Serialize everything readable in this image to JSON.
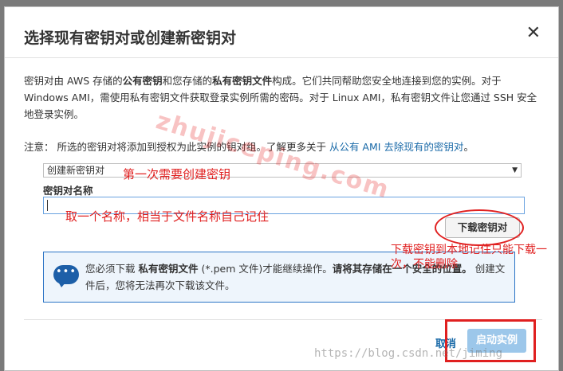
{
  "dialog": {
    "title": "选择现有密钥对或创建新密钥对",
    "close_glyph": "✕",
    "intro_part1": "密钥对由 AWS 存储的",
    "intro_bold1": "公有密钥",
    "intro_part2": "和您存储的",
    "intro_bold2": "私有密钥文件",
    "intro_part3": "构成。它们共同帮助您安全地连接到您的实例。对于 Windows AMI，需使用私有密钥文件获取登录实例所需的密码。对于 Linux AMI，私有密钥文件让您通过 SSH 安全地登录实例。",
    "note_text": "注意：  所选的密钥对将添加到授权为此实例的钥对组。了解更多关于 ",
    "note_link": "从公有 AMI 去除现有的密钥对",
    "note_end": "。",
    "select_value": "创建新密钥对",
    "name_label": "密钥对名称",
    "name_value": "",
    "download_button": "下载密钥对",
    "info_icon": "•••",
    "info_part1": "您必须下载 ",
    "info_bold1": "私有密钥文件",
    "info_part2": " (*.pem 文件)才能继续操作。",
    "info_bold2": "请将其存储在一个安全的位置。",
    "info_part3": " 创建文件后，您将无法再次下载该文件。",
    "cancel_label": "取消",
    "launch_label": "启动实例"
  },
  "annotations": {
    "select_note": "第一次需要创建密钥",
    "name_note": "取一个名称，相当于文件名称自己记住",
    "download_note": "下载密钥到本地记住只能下载一次，不能删除"
  },
  "watermarks": {
    "site": "zhujiceping.com",
    "blog": "https://blog.csdn.net/jiming"
  },
  "colors": {
    "accent_link": "#1a6aa8",
    "annotation_red": "#e02020",
    "info_border": "#2b74c5",
    "launch_button": "#9cc7ea"
  }
}
